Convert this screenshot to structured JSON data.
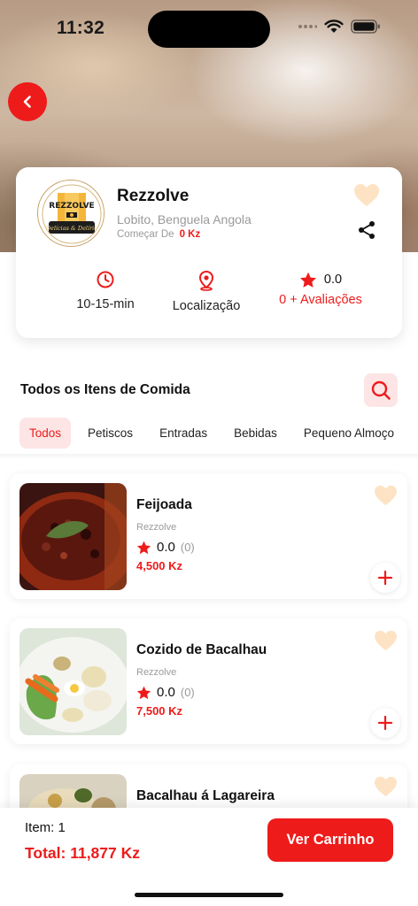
{
  "status_bar": {
    "time": "11:32"
  },
  "restaurant": {
    "name": "Rezzolve",
    "location": "Lobito, Benguela Angola",
    "start_label": "Começar De",
    "start_value": "0 Kz",
    "logo": {
      "brand_text": "REZZOLVE",
      "tagline": "Delícias & Delírio"
    }
  },
  "stats": {
    "time_label": "10-15-min",
    "location_label": "Localização",
    "rating_value": "0.0",
    "reviews_label": "0 + Avaliações"
  },
  "section": {
    "title": "Todos os Itens de Comida"
  },
  "tabs": [
    {
      "label": "Todos",
      "active": true
    },
    {
      "label": "Petiscos",
      "active": false
    },
    {
      "label": "Entradas",
      "active": false
    },
    {
      "label": "Bebidas",
      "active": false
    },
    {
      "label": "Pequeno Almoço",
      "active": false
    }
  ],
  "items": [
    {
      "name": "Feijoada",
      "restaurant": "Rezzolve",
      "rating": "0.0",
      "count": "(0)",
      "price": "4,500 Kz",
      "image": "feijoada-photo"
    },
    {
      "name": "Cozido de Bacalhau",
      "restaurant": "Rezzolve",
      "rating": "0.0",
      "count": "(0)",
      "price": "7,500 Kz",
      "image": "cozido-photo"
    },
    {
      "name": "Bacalhau á Lagareira",
      "restaurant": "",
      "rating": "",
      "count": "",
      "price": "",
      "image": "bacalhau-photo"
    }
  ],
  "cart": {
    "item_label": "Item: 1",
    "total_label": "Total: 11,877 Kz",
    "button_label": "Ver Carrinho"
  },
  "colors": {
    "accent": "#ee1b1b",
    "accent_soft": "#fde5e5",
    "heart": "#fde3c4"
  },
  "icons": [
    "back-arrow-icon",
    "heart-icon",
    "share-icon",
    "clock-icon",
    "location-pin-icon",
    "star-icon",
    "search-icon",
    "plus-icon",
    "wifi-icon",
    "battery-icon",
    "signal-icon"
  ]
}
